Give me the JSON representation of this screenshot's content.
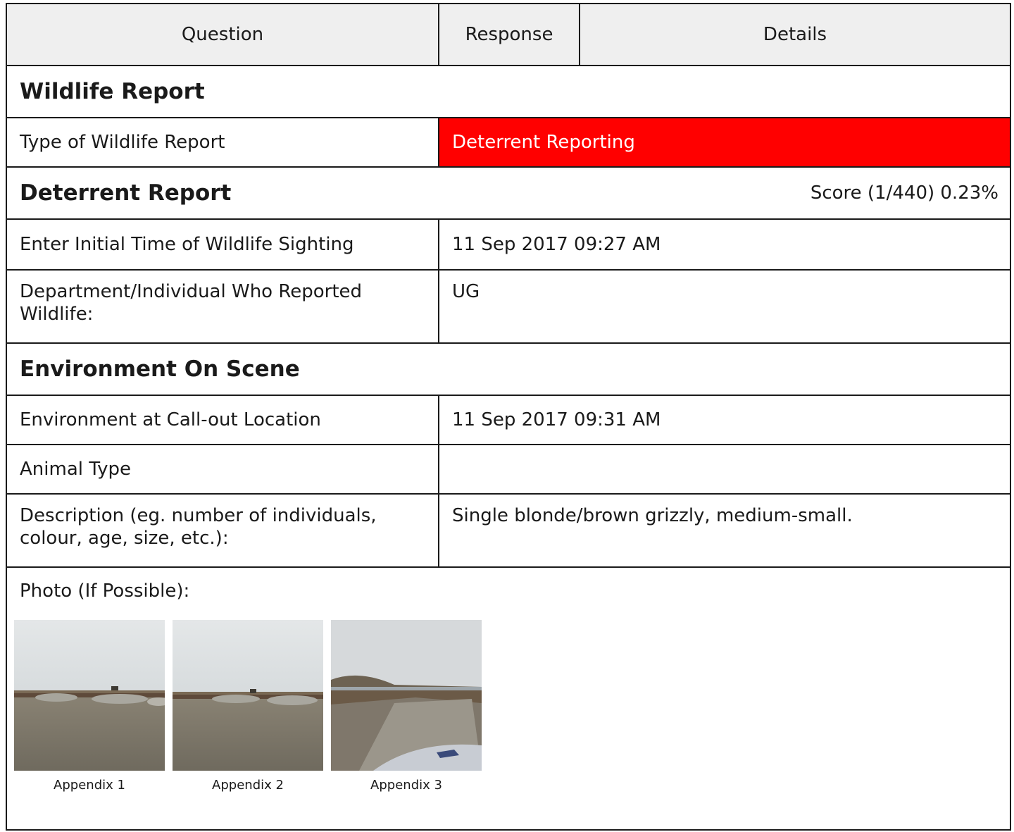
{
  "header": {
    "question": "Question",
    "response": "Response",
    "details": "Details"
  },
  "sections": {
    "wildlife_report": "Wildlife Report",
    "deterrent_report": "Deterrent Report",
    "deterrent_score": "Score (1/440) 0.23%",
    "environment": "Environment On Scene"
  },
  "rows": {
    "type_of_report": {
      "question": "Type of Wildlife Report",
      "answer": "Deterrent Reporting"
    },
    "initial_time": {
      "question": "Enter Initial Time of Wildlife Sighting",
      "answer": "11 Sep 2017 09:27 AM"
    },
    "reported_by": {
      "question": "Department/Individual Who Reported Wildlife:",
      "answer": "UG"
    },
    "env_location": {
      "question": "Environment at Call-out Location",
      "answer": "11 Sep 2017 09:31 AM"
    },
    "animal_type": {
      "question": "Animal Type",
      "answer": ""
    },
    "description": {
      "question": "Description (eg. number of individuals, colour, age, size, etc.):",
      "answer": "Single blonde/brown grizzly, medium-small."
    }
  },
  "photo": {
    "label": "Photo (If Possible):",
    "captions": [
      "Appendix 1",
      "Appendix 2",
      "Appendix 3"
    ]
  },
  "colors": {
    "flag_bg": "#ff0000",
    "header_bg": "#efefef",
    "border": "#1a1a1a"
  }
}
